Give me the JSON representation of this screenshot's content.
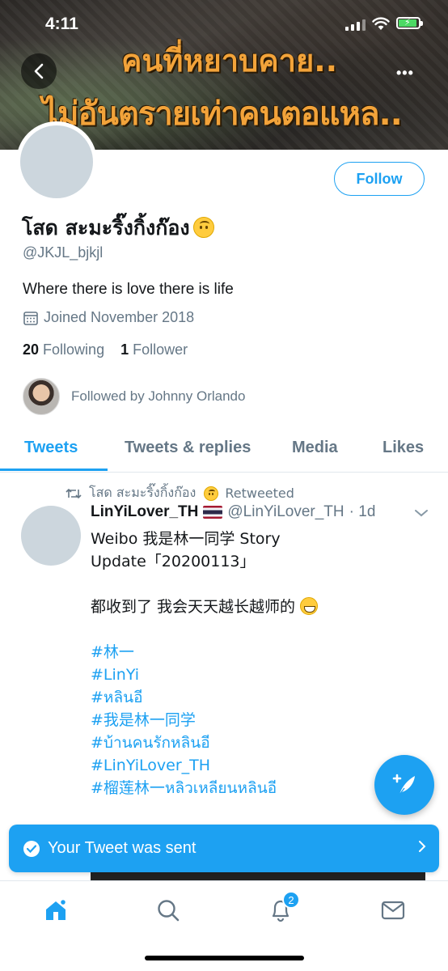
{
  "status_bar": {
    "time": "4:11"
  },
  "banner": {
    "line1": "คนที่หยาบคาย..",
    "line2": "ไม่อันตรายเท่าคนตอแหล.."
  },
  "profile": {
    "follow_label": "Follow",
    "display_name": "โสด สะมะริ๊งกิ้งก๊อง",
    "handle": "@JKJL_bjkjl",
    "bio": "Where there is love there is life",
    "joined": "Joined November 2018",
    "following_count": "20",
    "following_label": "Following",
    "followers_count": "1",
    "followers_label": "Follower",
    "followed_by": "Followed by Johnny Orlando"
  },
  "tabs": [
    {
      "label": "Tweets",
      "active": true
    },
    {
      "label": "Tweets & replies",
      "active": false
    },
    {
      "label": "Media",
      "active": false
    },
    {
      "label": "Likes",
      "active": false
    }
  ],
  "tweet": {
    "retweeted_by": "โสด สะมะริ๊งกิ้งก๊อง",
    "retweeted_label": "Retweeted",
    "author": "LinYiLover_TH",
    "handle": "@LinYiLover_TH",
    "time": "· 1d",
    "lines": [
      "Weibo 我是林一同学 Story",
      "Update「20200113」",
      "",
      "都收到了 我会天天越长越师的"
    ],
    "hashtags": [
      "#林一",
      "#LinYi",
      "#หลินอี",
      "#我是林一同学",
      "#บ้านคนรักหลินอี",
      "#LinYiLover_TH",
      "#榴莲林一หลิวเหลียนหลินอี"
    ]
  },
  "toast": {
    "message": "Your Tweet was sent"
  },
  "bottom_nav": {
    "notifications_badge": "2"
  },
  "colors": {
    "accent": "#1da1f2",
    "text": "#14171a",
    "secondary": "#657786"
  }
}
